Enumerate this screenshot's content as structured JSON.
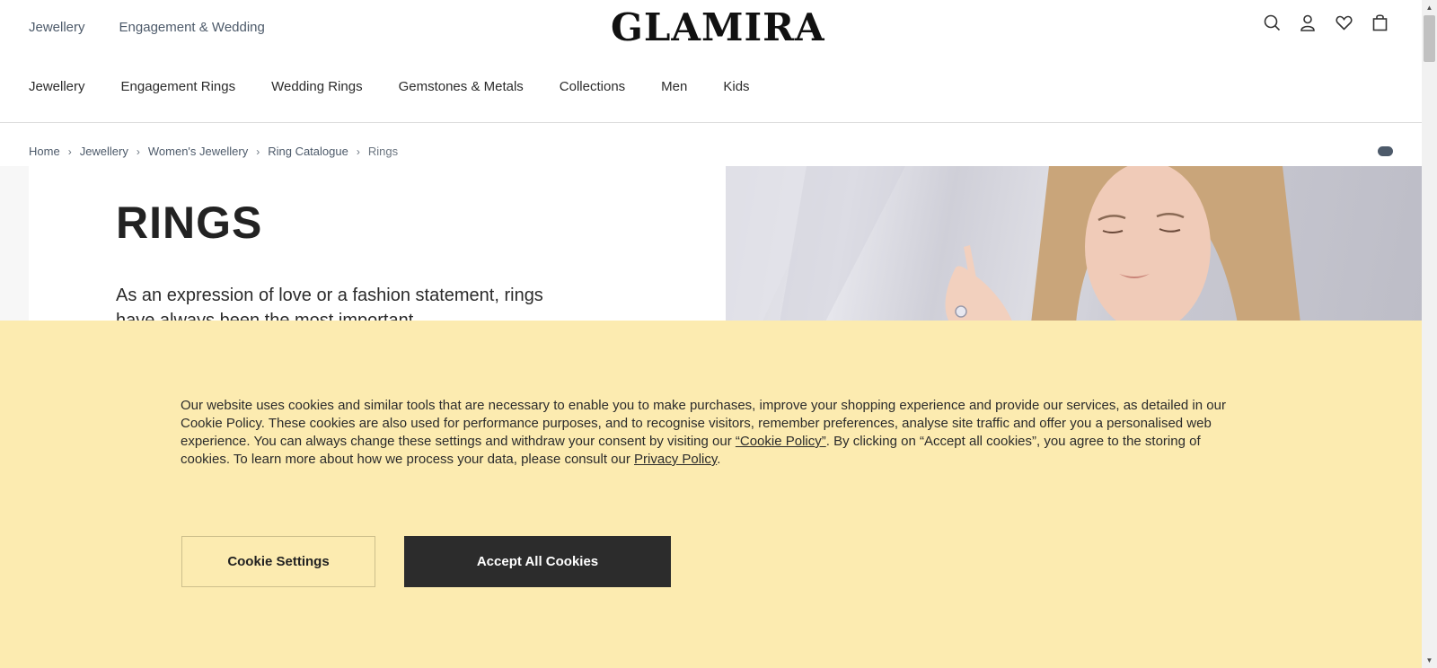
{
  "header": {
    "top_links": [
      "Jewellery",
      "Engagement & Wedding"
    ],
    "logo": "GLAMIRA",
    "icons": [
      "search-icon",
      "account-icon",
      "wishlist-icon",
      "cart-icon"
    ]
  },
  "nav": {
    "items": [
      "Jewellery",
      "Engagement Rings",
      "Wedding Rings",
      "Gemstones & Metals",
      "Collections",
      "Men",
      "Kids"
    ]
  },
  "breadcrumb": [
    "Home",
    "Jewellery",
    "Women's Jewellery",
    "Ring Catalogue",
    "Rings"
  ],
  "hero": {
    "title": "RINGS",
    "description": "As an expression of love or a fashion statement, rings have always been the most important"
  },
  "cookie": {
    "text_1": "Our website uses cookies and similar tools that are necessary to enable you to make purchases, improve your shopping experience and provide our services, as detailed in our Cookie Policy. These cookies are also used for performance purposes, and to recognise visitors, remember preferences, analyse site traffic and offer you a personalised web experience. You can always change these settings and withdraw your consent by visiting our ",
    "cookie_policy_link": "“Cookie Policy”",
    "text_2": ". By clicking on “Accept all cookies”, you agree to the storing of cookies. To learn more about how we process your data, please consult our ",
    "privacy_link": "Privacy Policy",
    "text_3": ".",
    "settings_button": "Cookie Settings",
    "accept_button": "Accept All Cookies"
  },
  "colors": {
    "cookie_bg": "#fcebb0",
    "accept_bg": "#2c2c2c",
    "link": "#4d5a6a"
  }
}
